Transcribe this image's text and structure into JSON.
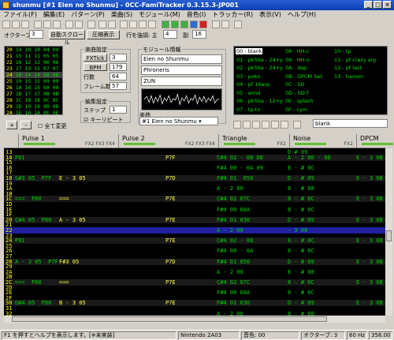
{
  "window": {
    "title": "shunmu [#1 Eien no Shunmu] - 0CC-FamiTracker 0.3.15.3-JP001",
    "min": "_",
    "max": "□",
    "close": "×"
  },
  "menu": [
    "ファイル(F)",
    "編集(E)",
    "パターン(P)",
    "楽曲(S)",
    "モジュール(M)",
    "音色(I)",
    "トラッカー(R)",
    "表示(V)",
    "ヘルプ(H)"
  ],
  "options": {
    "octave_label": "オクターブ",
    "octave": "3",
    "autoscroll": "自動スクロール",
    "compact": "圧縮表示",
    "highlight_label": "行を強調: 主",
    "hl_primary": "4",
    "hl_secondary_label": "副",
    "hl_secondary": "16"
  },
  "frames": [
    {
      "n": "20",
      "v": "14 10 10 04 04"
    },
    {
      "n": "21",
      "v": "15 11 11 05 05"
    },
    {
      "n": "22",
      "v": "16 12 12 06 06"
    },
    {
      "n": "23",
      "v": "17 13 13 07 07"
    },
    {
      "n": "24",
      "v": "18 14 14 08 08"
    },
    {
      "n": "25",
      "v": "19 15 15 09 09"
    },
    {
      "n": "26",
      "v": "1A 16 16 0A 0A"
    },
    {
      "n": "27",
      "v": "1B 17 17 0B 0B"
    },
    {
      "n": "28",
      "v": "1C 18 18 0C 0C"
    },
    {
      "n": "29",
      "v": "1D 19 19 0D 0D"
    },
    {
      "n": "2A",
      "v": "1E 1A 1A 0E 0E"
    }
  ],
  "frame_buttons": {
    "add": "+",
    "remove": "-",
    "change_all": "全て変更"
  },
  "song_settings": {
    "title": "楽曲設定",
    "fxx": "FXTick",
    "fxx_val": "3",
    "bpm": "BPM",
    "bpm_val": "179",
    "rows": "行数",
    "rows_val": "64",
    "frames": "フレーム数",
    "frames_val": "57"
  },
  "edit_settings": {
    "title": "編集設定",
    "step": "ステップ",
    "step_val": "1",
    "keyrepeat": "キーリピート"
  },
  "module": {
    "title": "モジュール情報",
    "name": "Eien no Shunmu",
    "artist": "Phroneris",
    "copyright": "ZUN"
  },
  "song": {
    "label": "楽曲",
    "selected": "#1 Eien no Shunmu"
  },
  "instruments": [
    {
      "id": "00",
      "name": "blank"
    },
    {
      "id": "01",
      "name": "pk5ba - 24+y"
    },
    {
      "id": "02",
      "name": "pk5ba - 24+y"
    },
    {
      "id": "03",
      "name": "poko"
    },
    {
      "id": "04",
      "name": "pf 16arp"
    },
    {
      "id": "05",
      "name": "wind"
    },
    {
      "id": "06",
      "name": "pk5ba - 12+y"
    },
    {
      "id": "07",
      "name": "tp-tn"
    },
    {
      "id": "08",
      "name": "HH-c"
    },
    {
      "id": "09",
      "name": "HH-o"
    },
    {
      "id": "0A",
      "name": "dap"
    },
    {
      "id": "0B",
      "name": "DPCM Set"
    },
    {
      "id": "0C",
      "name": "SD"
    },
    {
      "id": "0D",
      "name": "SD-f"
    },
    {
      "id": "0E",
      "name": "splash"
    },
    {
      "id": "0F",
      "name": "cym"
    },
    {
      "id": "10",
      "name": "tp"
    },
    {
      "id": "11",
      "name": "pf crazy arp"
    },
    {
      "id": "12",
      "name": "pf last"
    },
    {
      "id": "13",
      "name": "hamon"
    }
  ],
  "instrument_name": "blank",
  "channels": [
    {
      "name": "Pulse 1",
      "fx": "FX2  FX3  FX4"
    },
    {
      "name": "Pulse 2",
      "fx": "FX2  FX3  FX4"
    },
    {
      "name": "Triangle",
      "fx": "FX2"
    },
    {
      "name": "Noise",
      "fx": "FX2"
    },
    {
      "name": "DPCM",
      "fx": ""
    }
  ],
  "rows": [
    {
      "n": "13",
      "c": [
        "",
        "",
        "",
        "",
        "D-# 09",
        ""
      ]
    },
    {
      "n": "14",
      "c": [
        "P81",
        "",
        "P7F",
        "C#4 02 - 08 D8",
        "A - 2 00 - 0D",
        "E - 3 0B"
      ]
    },
    {
      "n": "15",
      "c": [
        "",
        "",
        "",
        "",
        "",
        ""
      ]
    },
    {
      "n": "16",
      "c": [
        "",
        "",
        "",
        "F#4 00 - 0A 09",
        "8 - # 0C",
        ""
      ]
    },
    {
      "n": "17",
      "c": [
        "",
        "",
        "",
        "",
        "",
        ""
      ]
    },
    {
      "n": "18",
      "c": [
        "G#3 05  P7F",
        "E - 3 05",
        "P7D",
        "F#4 01  050",
        "D - # 09",
        "E - 3 0B"
      ]
    },
    {
      "n": "19",
      "c": [
        "",
        "",
        "",
        "",
        "",
        ""
      ]
    },
    {
      "n": "1A",
      "c": [
        "",
        "",
        "",
        "A - 2 00",
        "8 - # 08",
        ""
      ]
    },
    {
      "n": "1B",
      "c": [
        "",
        "",
        "",
        "",
        "",
        ""
      ]
    },
    {
      "n": "1C",
      "c": [
        "===  P80",
        "===",
        "P7E",
        "C#4 02 07C",
        "8 - # 0C",
        "E - 3 0B"
      ]
    },
    {
      "n": "1D",
      "c": [
        "",
        "",
        "",
        "",
        "",
        ""
      ]
    },
    {
      "n": "1E",
      "c": [
        "",
        "",
        "",
        "F#4 00 08A",
        "8 - # 0C",
        ""
      ]
    },
    {
      "n": "1F",
      "c": [
        "",
        "",
        "",
        "",
        "",
        ""
      ]
    },
    {
      "n": "20",
      "c": [
        "C#4 05  P80",
        "A - 3 05",
        "P7E",
        "F#4 01 030",
        "D - # 09",
        "E - 3 0B"
      ]
    },
    {
      "n": "21",
      "c": [
        "",
        "",
        "",
        "",
        "",
        ""
      ]
    },
    {
      "n": "22",
      "c": [
        "",
        "",
        "",
        "A - 2 00",
        "- 3 08",
        ""
      ]
    },
    {
      "n": "23",
      "c": [
        "",
        "",
        "",
        "",
        "",
        ""
      ]
    },
    {
      "n": "24",
      "c": [
        "P81",
        "",
        "P7E",
        "C#4 02 - 08",
        "8 - # 0C",
        "E - 3 0B"
      ]
    },
    {
      "n": "25",
      "c": [
        "",
        "",
        "",
        "",
        "",
        ""
      ]
    },
    {
      "n": "26",
      "c": [
        "",
        "",
        "",
        "F#4 00 - 0A",
        "8 - # 0C",
        ""
      ]
    },
    {
      "n": "27",
      "c": [
        "",
        "",
        "",
        "",
        "",
        ""
      ]
    },
    {
      "n": "28",
      "c": [
        "A - 3 05  P7F",
        "F#3 05",
        "P7D",
        "F#4 01 050",
        "D - # 09",
        "E - 3 0B"
      ]
    },
    {
      "n": "29",
      "c": [
        "",
        "",
        "",
        "",
        "",
        ""
      ]
    },
    {
      "n": "2A",
      "c": [
        "",
        "",
        "",
        "A - 2 00",
        "8 - # 08",
        ""
      ]
    },
    {
      "n": "2B",
      "c": [
        "",
        "",
        "",
        "",
        "",
        ""
      ]
    },
    {
      "n": "2C",
      "c": [
        "===  P80",
        "===",
        "P7E",
        "C#4 02 07C",
        "8 - # 0C",
        "E - 3 0B"
      ]
    },
    {
      "n": "2D",
      "c": [
        "",
        "",
        "",
        "",
        "",
        ""
      ]
    },
    {
      "n": "2E",
      "c": [
        "",
        "",
        "",
        "F#4 00 08A",
        "8 - # 0C",
        ""
      ]
    },
    {
      "n": "2F",
      "c": [
        "",
        "",
        "",
        "",
        "",
        ""
      ]
    },
    {
      "n": "30",
      "c": [
        "D#4 05  P80",
        "B - 3 05",
        "P7E",
        "F#4 01 030",
        "D - # 09",
        "E - 3 0B"
      ]
    },
    {
      "n": "31",
      "c": [
        "",
        "",
        "",
        "",
        "",
        ""
      ]
    },
    {
      "n": "32",
      "c": [
        "",
        "",
        "",
        "A - 2 00",
        "8 - # 08",
        ""
      ]
    }
  ],
  "status": {
    "help": "F1 を押すとヘルプを表示します。[※未実装]",
    "chip": "Nintendo 2A03",
    "instr": "音色: 00",
    "octave": "オクターブ: 3",
    "rate": "60 Hz",
    "tempo": "358.00"
  }
}
